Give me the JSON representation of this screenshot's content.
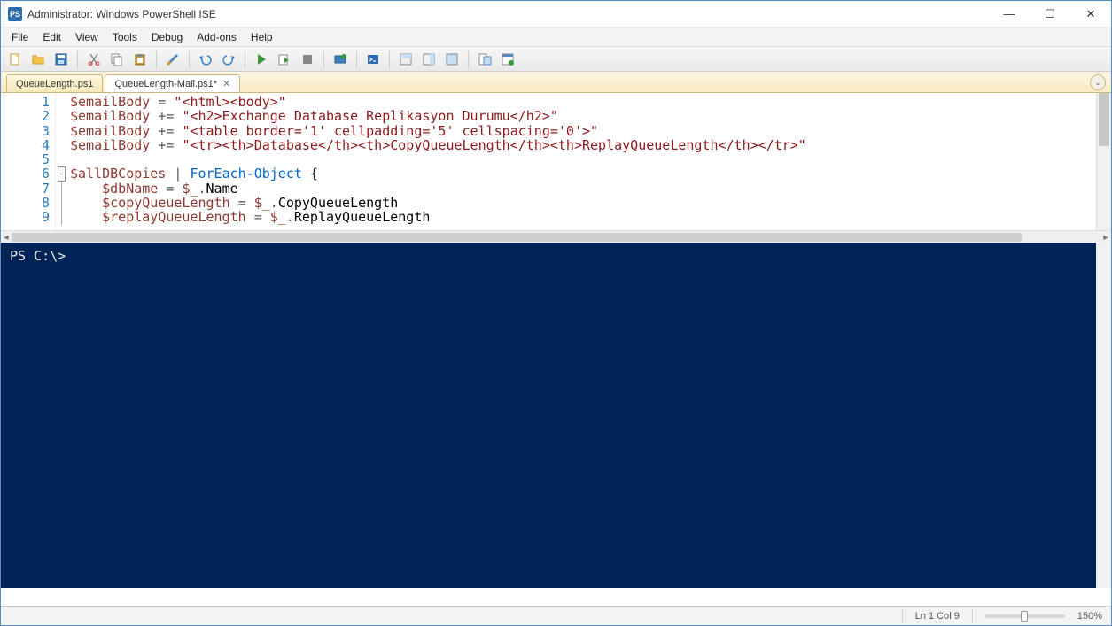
{
  "window": {
    "title": "Administrator: Windows PowerShell ISE",
    "app_abbr": "PS"
  },
  "menu": [
    "File",
    "Edit",
    "View",
    "Tools",
    "Debug",
    "Add-ons",
    "Help"
  ],
  "tabs": [
    {
      "label": "QueueLength.ps1",
      "dirty": false,
      "active": false
    },
    {
      "label": "QueueLength-Mail.ps1*",
      "dirty": true,
      "active": true
    }
  ],
  "editor": {
    "line_numbers": [
      "1",
      "2",
      "3",
      "4",
      "5",
      "6",
      "7",
      "8",
      "9"
    ],
    "lines": [
      [
        {
          "t": "$emailBody",
          "c": "tk-var"
        },
        {
          "t": " ",
          "c": ""
        },
        {
          "t": "=",
          "c": "tk-op"
        },
        {
          "t": " ",
          "c": ""
        },
        {
          "t": "\"<html><body>\"",
          "c": "tk-str"
        }
      ],
      [
        {
          "t": "$emailBody",
          "c": "tk-var"
        },
        {
          "t": " ",
          "c": ""
        },
        {
          "t": "+=",
          "c": "tk-op"
        },
        {
          "t": " ",
          "c": ""
        },
        {
          "t": "\"<h2>Exchange Database Replikasyon Durumu</h2>\"",
          "c": "tk-str"
        }
      ],
      [
        {
          "t": "$emailBody",
          "c": "tk-var"
        },
        {
          "t": " ",
          "c": ""
        },
        {
          "t": "+=",
          "c": "tk-op"
        },
        {
          "t": " ",
          "c": ""
        },
        {
          "t": "\"<table border='1' cellpadding='5' cellspacing='0'>\"",
          "c": "tk-str"
        }
      ],
      [
        {
          "t": "$emailBody",
          "c": "tk-var"
        },
        {
          "t": " ",
          "c": ""
        },
        {
          "t": "+=",
          "c": "tk-op"
        },
        {
          "t": " ",
          "c": ""
        },
        {
          "t": "\"<tr><th>Database</th><th>CopyQueueLength</th><th>ReplayQueueLength</th></tr>\"",
          "c": "tk-str"
        }
      ],
      [],
      [
        {
          "t": "$allDBCopies",
          "c": "tk-var"
        },
        {
          "t": " ",
          "c": ""
        },
        {
          "t": "|",
          "c": "tk-pipe"
        },
        {
          "t": " ",
          "c": ""
        },
        {
          "t": "ForEach-Object",
          "c": "tk-cmd"
        },
        {
          "t": " ",
          "c": ""
        },
        {
          "t": "{",
          "c": "tk-brace"
        }
      ],
      [
        {
          "t": "    ",
          "c": ""
        },
        {
          "t": "$dbName",
          "c": "tk-var"
        },
        {
          "t": " ",
          "c": ""
        },
        {
          "t": "=",
          "c": "tk-op"
        },
        {
          "t": " ",
          "c": ""
        },
        {
          "t": "$_",
          "c": "tk-var"
        },
        {
          "t": ".",
          "c": "tk-op"
        },
        {
          "t": "Name",
          "c": "tk-prop"
        }
      ],
      [
        {
          "t": "    ",
          "c": ""
        },
        {
          "t": "$copyQueueLength",
          "c": "tk-var"
        },
        {
          "t": " ",
          "c": ""
        },
        {
          "t": "=",
          "c": "tk-op"
        },
        {
          "t": " ",
          "c": ""
        },
        {
          "t": "$_",
          "c": "tk-var"
        },
        {
          "t": ".",
          "c": "tk-op"
        },
        {
          "t": "CopyQueueLength",
          "c": "tk-prop"
        }
      ],
      [
        {
          "t": "    ",
          "c": ""
        },
        {
          "t": "$replayQueueLength",
          "c": "tk-var"
        },
        {
          "t": " ",
          "c": ""
        },
        {
          "t": "=",
          "c": "tk-op"
        },
        {
          "t": " ",
          "c": ""
        },
        {
          "t": "$_",
          "c": "tk-var"
        },
        {
          "t": ".",
          "c": "tk-op"
        },
        {
          "t": "ReplayQueueLength",
          "c": "tk-prop"
        }
      ]
    ]
  },
  "console": {
    "prompt": "PS C:\\>"
  },
  "status": {
    "position": "Ln 1  Col 9",
    "zoom": "150%"
  }
}
